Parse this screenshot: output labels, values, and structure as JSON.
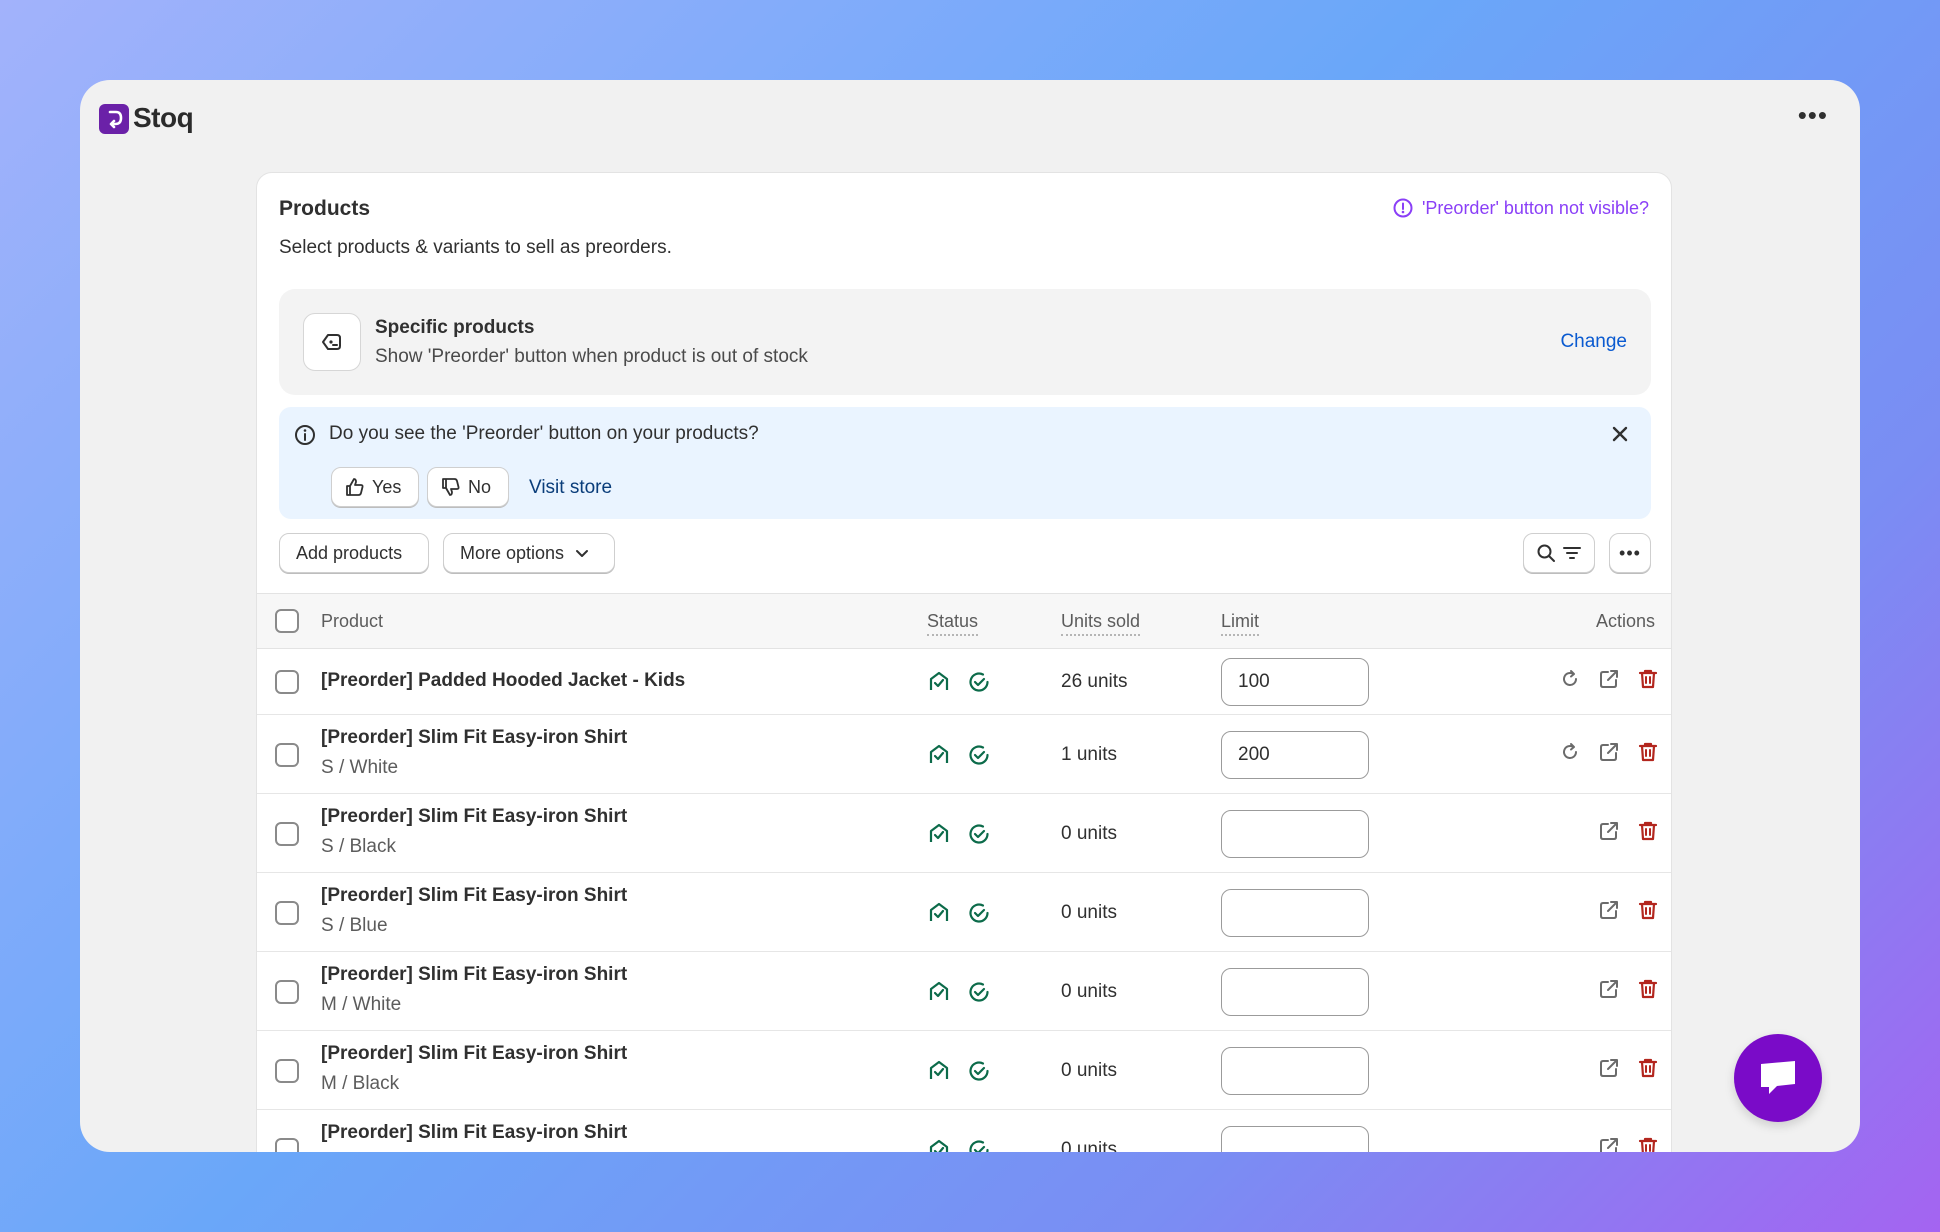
{
  "app": {
    "name": "Stoq"
  },
  "card": {
    "title": "Products",
    "help_link": "'Preorder' button not visible?",
    "subtitle": "Select products & variants to sell as preorders."
  },
  "mode": {
    "title": "Specific products",
    "description": "Show 'Preorder' button when product is out of stock",
    "change_label": "Change"
  },
  "banner": {
    "question": "Do you see the 'Preorder' button on your products?",
    "yes_label": "Yes",
    "no_label": "No",
    "visit_label": "Visit store"
  },
  "toolbar": {
    "add_label": "Add products",
    "more_label": "More options"
  },
  "table": {
    "headers": {
      "product": "Product",
      "status": "Status",
      "units": "Units sold",
      "limit": "Limit",
      "actions": "Actions"
    },
    "rows": [
      {
        "name": "[Preorder] Padded Hooded Jacket - Kids",
        "variant": "",
        "units": "26 units",
        "limit": "100",
        "reset": true
      },
      {
        "name": "[Preorder] Slim Fit Easy-iron Shirt",
        "variant": "S / White",
        "units": "1 units",
        "limit": "200",
        "reset": true
      },
      {
        "name": "[Preorder] Slim Fit Easy-iron Shirt",
        "variant": "S / Black",
        "units": "0 units",
        "limit": "",
        "reset": false
      },
      {
        "name": "[Preorder] Slim Fit Easy-iron Shirt",
        "variant": "S / Blue",
        "units": "0 units",
        "limit": "",
        "reset": false
      },
      {
        "name": "[Preorder] Slim Fit Easy-iron Shirt",
        "variant": "M / White",
        "units": "0 units",
        "limit": "",
        "reset": false
      },
      {
        "name": "[Preorder] Slim Fit Easy-iron Shirt",
        "variant": "M / Black",
        "units": "0 units",
        "limit": "",
        "reset": false
      },
      {
        "name": "[Preorder] Slim Fit Easy-iron Shirt",
        "variant": "",
        "units": "0 units",
        "limit": "",
        "reset": false
      }
    ]
  },
  "colors": {
    "brand": "#6b21a8",
    "link": "#0a5ad0",
    "help": "#8a3ff7",
    "status_green": "#0c6b4a",
    "delete_red": "#b3261e",
    "chat": "#7a0bc8"
  },
  "icons": {
    "status_store": "store-check-icon",
    "status_active": "check-circle-icon",
    "reset": "refresh-icon",
    "open": "external-link-icon",
    "delete": "trash-icon"
  }
}
